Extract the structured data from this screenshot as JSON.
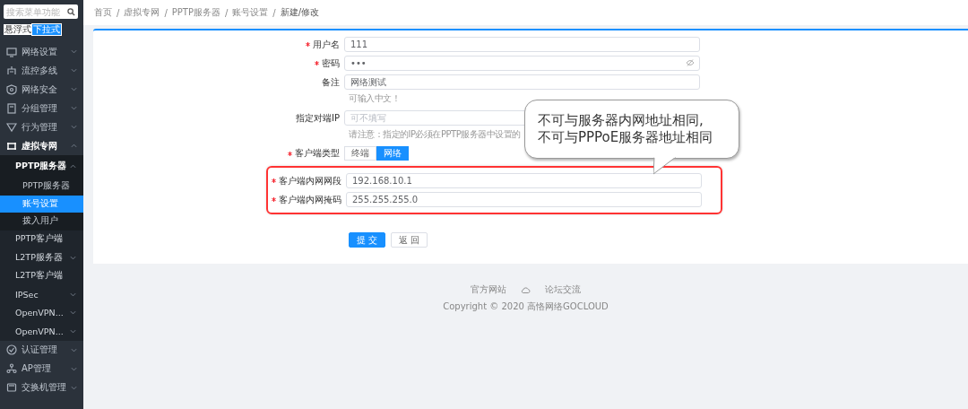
{
  "sidebar": {
    "search": {
      "placeholder": "搜索菜单功能"
    },
    "mode_toggle": [
      {
        "label": "悬浮式",
        "selected": false
      },
      {
        "label": "下拉式",
        "selected": true
      }
    ],
    "menu": [
      {
        "label": "网络设置",
        "expanded": false
      },
      {
        "label": "流控多线",
        "expanded": false
      },
      {
        "label": "网络安全",
        "expanded": false
      },
      {
        "label": "分组管理",
        "expanded": false
      },
      {
        "label": "行为管理",
        "expanded": false
      },
      {
        "label": "虚拟专网",
        "expanded": true,
        "children": [
          {
            "label": "PPTP服务器",
            "expanded": true,
            "children": [
              {
                "label": "PPTP服务器",
                "selected": false
              },
              {
                "label": "账号设置",
                "selected": true
              },
              {
                "label": "拨入用户",
                "selected": false
              }
            ]
          },
          {
            "label": "PPTP客户端"
          },
          {
            "label": "L2TP服务器",
            "expanded": false
          },
          {
            "label": "L2TP客户端"
          },
          {
            "label": "IPSec",
            "expanded": false
          },
          {
            "label": "OpenVPN...",
            "expanded": false
          },
          {
            "label": "OpenVPN...",
            "expanded": false
          }
        ]
      },
      {
        "label": "认证管理",
        "expanded": false
      },
      {
        "label": "AP管理",
        "expanded": false
      },
      {
        "label": "交换机管理",
        "expanded": false
      }
    ]
  },
  "breadcrumb": {
    "separator": "/",
    "items": [
      "首页",
      "虚拟专网",
      "PPTP服务器",
      "账号设置",
      "新建/修改"
    ]
  },
  "form": {
    "rows": [
      {
        "kind": "text",
        "label": "用户名",
        "required": true,
        "value": "111"
      },
      {
        "kind": "password",
        "label": "密码",
        "required": true,
        "value": "•••"
      },
      {
        "kind": "text",
        "label": "备注",
        "required": false,
        "value": "网络测试",
        "hint": "可输入中文！"
      },
      {
        "kind": "text",
        "label": "指定对端IP",
        "required": false,
        "placeholder": "可不填写",
        "hint": "请注意：指定的IP必须在PPTP服务器中设置的"
      },
      {
        "kind": "segmented",
        "label": "客户端类型",
        "required": true,
        "options": [
          {
            "label": "终端",
            "selected": false
          },
          {
            "label": "网络",
            "selected": true
          }
        ]
      },
      {
        "kind": "text",
        "label": "客户端内网网段",
        "required": true,
        "value": "192.168.10.1",
        "highlighted": true
      },
      {
        "kind": "text",
        "label": "客户端内网掩码",
        "required": true,
        "value": "255.255.255.0",
        "highlighted": true
      }
    ],
    "buttons": [
      {
        "label": "提 交",
        "kind": "primary"
      },
      {
        "label": "返 回",
        "kind": "default"
      }
    ]
  },
  "callout": {
    "lines": [
      "不可与服务器内网地址相同,",
      "不可与PPPoE服务器地址相同"
    ]
  },
  "footer": {
    "links": [
      "官方网站",
      "论坛交流"
    ],
    "copyright": "Copyright © 2020 高恪网络GOCLOUD"
  }
}
